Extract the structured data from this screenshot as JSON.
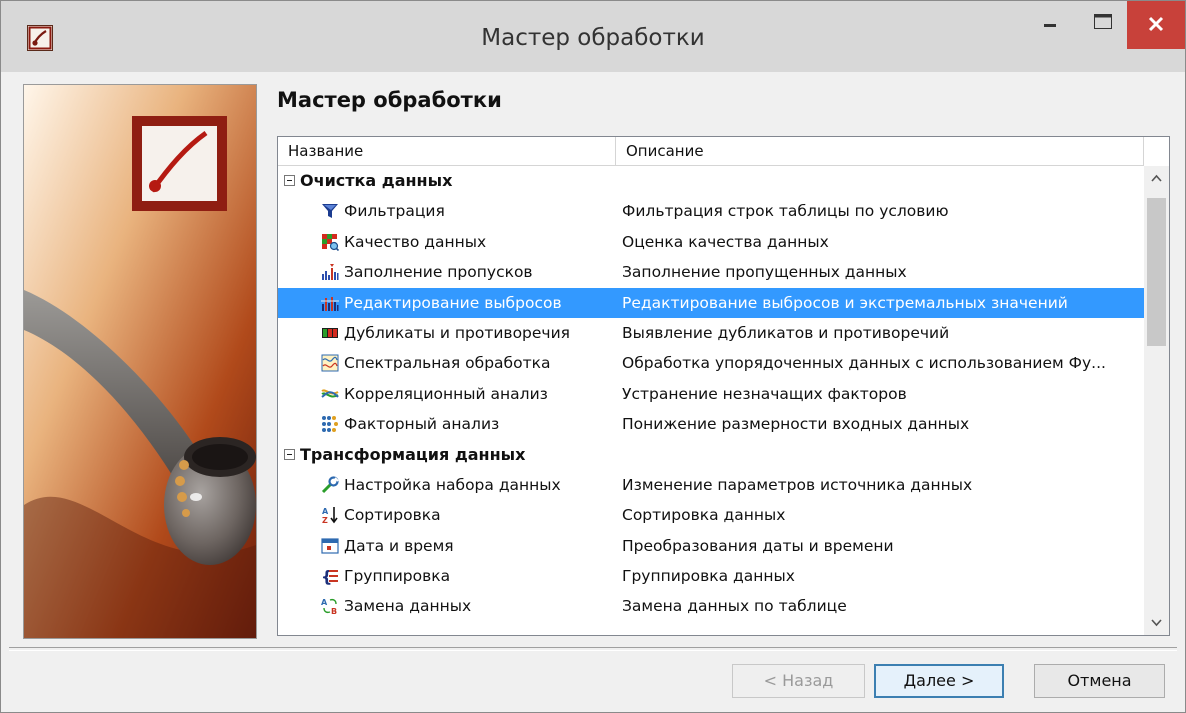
{
  "window": {
    "title": "Мастер обработки",
    "controls": [
      "minimize-icon",
      "maximize-icon",
      "close-icon"
    ]
  },
  "page": {
    "heading": "Мастер обработки"
  },
  "table": {
    "columns": [
      "Название",
      "Описание"
    ],
    "groups": [
      {
        "label": "Очистка данных",
        "expanded": true,
        "items": [
          {
            "icon": "filter-icon",
            "name": "Фильтрация",
            "description": "Фильтрация строк таблицы по условию"
          },
          {
            "icon": "data-quality-icon",
            "name": "Качество данных",
            "description": "Оценка качества данных"
          },
          {
            "icon": "fill-gaps-icon",
            "name": "Заполнение пропусков",
            "description": "Заполнение пропущенных данных"
          },
          {
            "icon": "outliers-icon",
            "name": "Редактирование выбросов",
            "description": "Редактирование выбросов и экстремальных значений",
            "selected": true
          },
          {
            "icon": "duplicates-icon",
            "name": "Дубликаты и противоречия",
            "description": "Выявление дубликатов и противоречий"
          },
          {
            "icon": "spectral-icon",
            "name": "Спектральная обработка",
            "description": "Обработка упорядоченных данных с использованием Фу..."
          },
          {
            "icon": "correlation-icon",
            "name": "Корреляционный анализ",
            "description": "Устранение незначащих факторов"
          },
          {
            "icon": "factor-analysis-icon",
            "name": "Факторный анализ",
            "description": "Понижение размерности входных данных"
          }
        ]
      },
      {
        "label": "Трансформация данных",
        "expanded": true,
        "items": [
          {
            "icon": "dataset-settings-icon",
            "name": "Настройка набора данных",
            "description": "Изменение параметров источника данных"
          },
          {
            "icon": "sort-az-icon",
            "name": "Сортировка",
            "description": "Сортировка данных"
          },
          {
            "icon": "calendar-icon",
            "name": "Дата и время",
            "description": "Преобразования даты и времени"
          },
          {
            "icon": "grouping-icon",
            "name": "Группировка",
            "description": "Группировка данных"
          },
          {
            "icon": "replace-icon",
            "name": "Замена данных",
            "description": "Замена данных по таблице"
          }
        ]
      }
    ]
  },
  "buttons": {
    "back": "< Назад",
    "next": "Далее >",
    "cancel": "Отмена"
  },
  "colors": {
    "selection": "#3399ff",
    "close_button": "#c8413a",
    "default_button_border": "#3c7fb1"
  }
}
